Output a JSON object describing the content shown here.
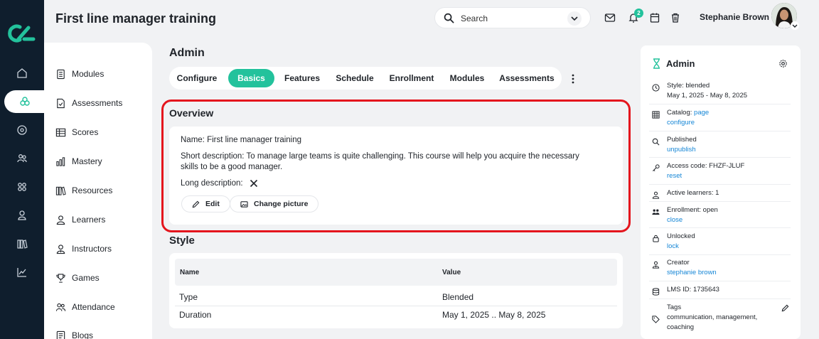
{
  "app": {
    "title": "First line manager training"
  },
  "search": {
    "placeholder": "Search"
  },
  "notifications": {
    "count": "2"
  },
  "user": {
    "name": "Stephanie Brown"
  },
  "subnav": {
    "items": [
      {
        "label": "Modules",
        "icon": "modules-icon"
      },
      {
        "label": "Assessments",
        "icon": "assessments-icon"
      },
      {
        "label": "Scores",
        "icon": "scores-icon"
      },
      {
        "label": "Mastery",
        "icon": "mastery-icon"
      },
      {
        "label": "Resources",
        "icon": "resources-icon"
      },
      {
        "label": "Learners",
        "icon": "learners-icon"
      },
      {
        "label": "Instructors",
        "icon": "instructors-icon"
      },
      {
        "label": "Games",
        "icon": "trophy-icon"
      },
      {
        "label": "Attendance",
        "icon": "attendance-icon"
      },
      {
        "label": "Blogs",
        "icon": "blogs-icon"
      }
    ]
  },
  "main": {
    "heading": "Admin",
    "tabs": [
      "Configure",
      "Basics",
      "Features",
      "Schedule",
      "Enrollment",
      "Modules",
      "Assessments"
    ],
    "active_tab": "Basics"
  },
  "overview": {
    "heading": "Overview",
    "name_line": "Name: First line manager training",
    "short_line1": "Short description: To manage large teams is quite challenging. This course will help you acquire the necessary",
    "short_line2": "skills to be a good manager.",
    "long_label": "Long description:",
    "edit_label": "Edit",
    "change_picture_label": "Change picture"
  },
  "style": {
    "heading": "Style",
    "columns": [
      "Name",
      "Value"
    ],
    "rows": [
      [
        "Type",
        "Blended"
      ],
      [
        "Duration",
        "May 1, 2025 .. May 8, 2025"
      ]
    ]
  },
  "right_panel": {
    "title": "Admin",
    "style": {
      "label": "Style: blended",
      "sub": "May 1, 2025 - May 8, 2025"
    },
    "catalog": {
      "label": "Catalog: ",
      "link1": "page",
      "link2": "configure"
    },
    "published": {
      "label": "Published",
      "link": "unpublish"
    },
    "access": {
      "label": "Access code: FHZF-JLUF",
      "link": "reset"
    },
    "learners": {
      "label": "Active learners: 1"
    },
    "enrollment": {
      "label": "Enrollment: open",
      "link": "close"
    },
    "unlocked": {
      "label": "Unlocked",
      "link": "lock"
    },
    "creator": {
      "label": "Creator",
      "link": "stephanie brown"
    },
    "lms": {
      "label": "LMS ID: 1735643"
    },
    "tags": {
      "label": "Tags",
      "value1": "communication, management,",
      "value2": "coaching"
    }
  },
  "colors": {
    "accent": "#23c29c",
    "rail": "#0f1e2d",
    "highlight": "#e4151d",
    "link": "#1586d6"
  }
}
